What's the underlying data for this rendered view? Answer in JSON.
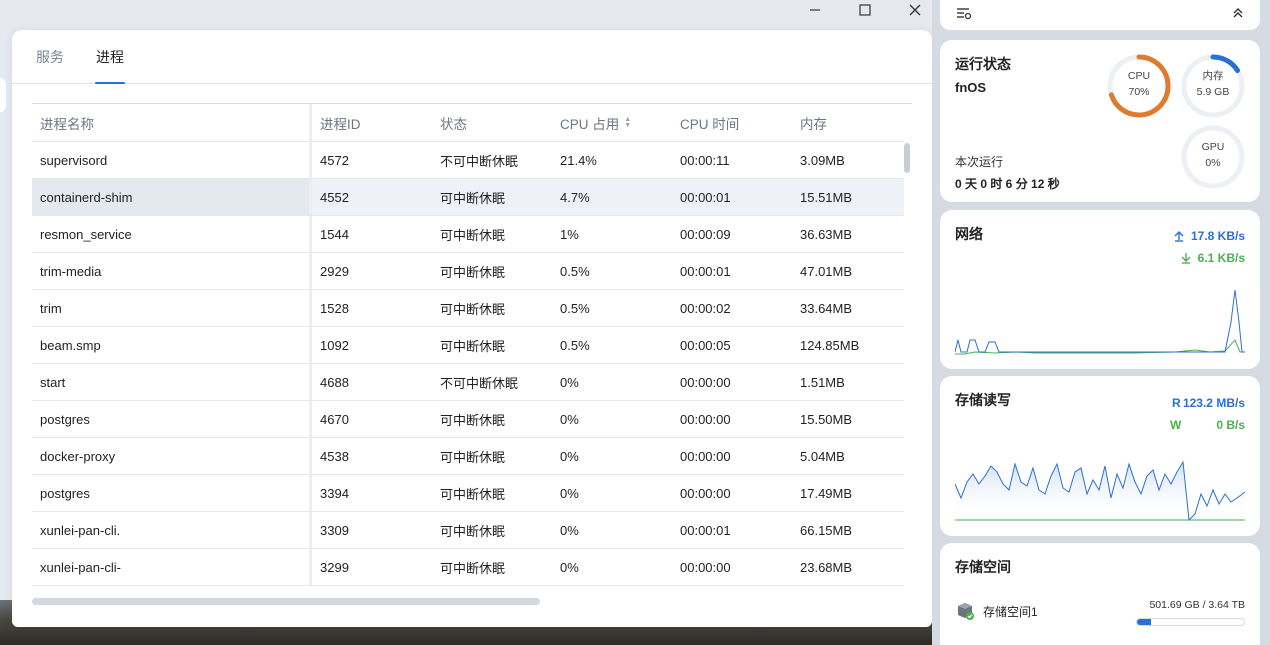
{
  "window": {
    "tabs": [
      {
        "label": "服务"
      },
      {
        "label": "进程"
      }
    ],
    "active_tab": "进程",
    "columns": [
      "进程名称",
      "进程ID",
      "状态",
      "CPU 占用",
      "CPU 时间",
      "内存"
    ],
    "rows": [
      {
        "name": "supervisord",
        "pid": "4572",
        "state": "不可中断休眠",
        "cpu": "21.4%",
        "time": "00:00:11",
        "mem": "3.09MB"
      },
      {
        "name": "containerd-shim",
        "pid": "4552",
        "state": "可中断休眠",
        "cpu": "4.7%",
        "time": "00:00:01",
        "mem": "15.51MB"
      },
      {
        "name": "resmon_service",
        "pid": "1544",
        "state": "可中断休眠",
        "cpu": "1%",
        "time": "00:00:09",
        "mem": "36.63MB"
      },
      {
        "name": "trim-media",
        "pid": "2929",
        "state": "可中断休眠",
        "cpu": "0.5%",
        "time": "00:00:01",
        "mem": "47.01MB"
      },
      {
        "name": "trim",
        "pid": "1528",
        "state": "可中断休眠",
        "cpu": "0.5%",
        "time": "00:00:02",
        "mem": "33.64MB"
      },
      {
        "name": "beam.smp",
        "pid": "1092",
        "state": "可中断休眠",
        "cpu": "0.5%",
        "time": "00:00:05",
        "mem": "124.85MB"
      },
      {
        "name": "start",
        "pid": "4688",
        "state": "不可中断休眠",
        "cpu": "0%",
        "time": "00:00:00",
        "mem": "1.51MB"
      },
      {
        "name": "postgres",
        "pid": "4670",
        "state": "可中断休眠",
        "cpu": "0%",
        "time": "00:00:00",
        "mem": "15.50MB"
      },
      {
        "name": "docker-proxy",
        "pid": "4538",
        "state": "可中断休眠",
        "cpu": "0%",
        "time": "00:00:00",
        "mem": "5.04MB"
      },
      {
        "name": "postgres",
        "pid": "3394",
        "state": "可中断休眠",
        "cpu": "0%",
        "time": "00:00:00",
        "mem": "17.49MB"
      },
      {
        "name": "xunlei-pan-cli.",
        "pid": "3309",
        "state": "可中断休眠",
        "cpu": "0%",
        "time": "00:00:01",
        "mem": "66.15MB"
      },
      {
        "name": "xunlei-pan-cli-",
        "pid": "3299",
        "state": "可中断休眠",
        "cpu": "0%",
        "time": "00:00:00",
        "mem": "23.68MB"
      }
    ],
    "highlight_row": 1
  },
  "panel": {
    "top_icons": [
      "widget-settings-icon",
      "collapse-icon"
    ],
    "status": {
      "title": "运行状态",
      "os": "fnOS",
      "uptime_label": "本次运行",
      "uptime": "0 天 0 时 6 分 12 秒",
      "cpu": {
        "label": "CPU",
        "value": "70%",
        "fraction": 0.7,
        "color": "#e07a2c"
      },
      "mem": {
        "label": "内存",
        "value": "5.9 GB",
        "fraction": 0.16,
        "color": "#2a6fd6"
      },
      "gpu": {
        "label": "GPU",
        "value": "0%",
        "fraction": 0.0
      }
    },
    "network": {
      "title": "网络",
      "up": "17.8 KB/s",
      "down": "6.1 KB/s",
      "up_color": "#2a6fd6",
      "down_color": "#4caf50"
    },
    "disk_io": {
      "title": "存储读写",
      "r_label": "R",
      "r": "123.2 MB/s",
      "w_label": "W",
      "w": "0 B/s"
    },
    "storage": {
      "title": "存储空间",
      "name": "存储空间1",
      "usage": "501.69 GB / 3.64 TB",
      "fraction": 0.135
    }
  }
}
